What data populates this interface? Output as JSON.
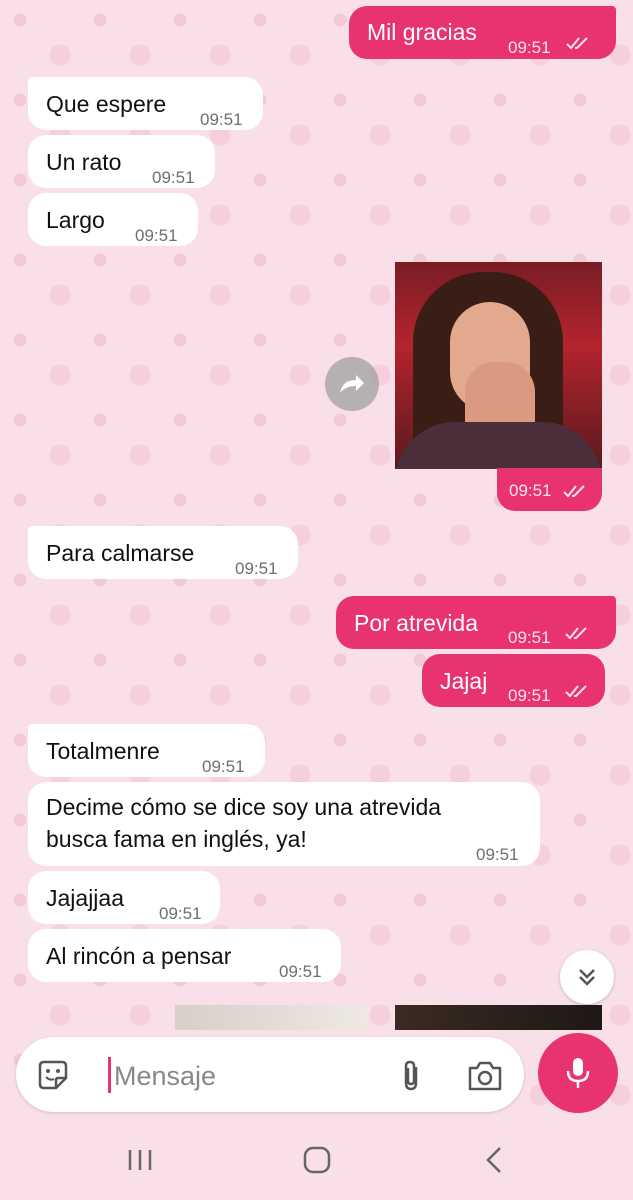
{
  "messages": [
    {
      "dir": "out",
      "text": "Mil gracias",
      "time": "09:51"
    },
    {
      "dir": "in",
      "text": "Que espere",
      "time": "09:51"
    },
    {
      "dir": "in",
      "text": "Un rato",
      "time": "09:51"
    },
    {
      "dir": "in",
      "text": "Largo",
      "time": "09:51"
    },
    {
      "dir": "out",
      "type": "image",
      "time": "09:51"
    },
    {
      "dir": "in",
      "text": "Para calmarse",
      "time": "09:51"
    },
    {
      "dir": "out",
      "text": "Por atrevida",
      "time": "09:51"
    },
    {
      "dir": "out",
      "text": "Jajaj",
      "time": "09:51"
    },
    {
      "dir": "in",
      "text": "Totalmenre",
      "time": "09:51"
    },
    {
      "dir": "in",
      "text_line1": "Decime cómo se dice soy una atrevida",
      "text_line2": "busca fama en inglés, ya!",
      "time": "09:51"
    },
    {
      "dir": "in",
      "text": "Jajajjaa",
      "time": "09:51"
    },
    {
      "dir": "in",
      "text": "Al rincón a pensar",
      "time": "09:51"
    }
  ],
  "composer": {
    "placeholder": "Mensaje",
    "icons": [
      "sticker-icon",
      "attach-icon",
      "camera-icon",
      "mic-icon"
    ]
  },
  "nav_icons": [
    "recents-icon",
    "home-icon",
    "back-icon"
  ],
  "colors": {
    "accent": "#e8336f",
    "background": "#f9dfe7",
    "incoming_bubble": "#ffffff"
  }
}
